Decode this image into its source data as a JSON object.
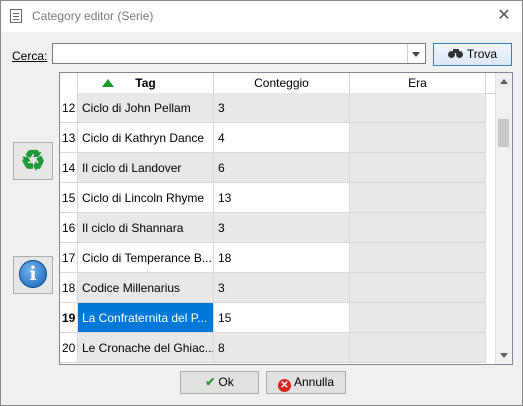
{
  "window": {
    "title": "Category editor (Serie)",
    "close_glyph": "✕"
  },
  "search": {
    "label": "Cerca:",
    "value": "",
    "find_label": "Trova"
  },
  "side_buttons": {
    "recycle_icon": "recycle-icon",
    "info_icon": "info-icon",
    "info_glyph": "i",
    "recycle_glyph": "♻"
  },
  "grid": {
    "columns": [
      "Tag",
      "Conteggio",
      "Era"
    ],
    "sorted_column": "Tag",
    "rows": [
      {
        "num": "12",
        "tag": "Ciclo di John Pellam",
        "count": "3",
        "era": ""
      },
      {
        "num": "13",
        "tag": "Ciclo di Kathryn Dance",
        "count": "4",
        "era": ""
      },
      {
        "num": "14",
        "tag": "Il ciclo di Landover",
        "count": "6",
        "era": ""
      },
      {
        "num": "15",
        "tag": "Ciclo di Lincoln Rhyme",
        "count": "13",
        "era": ""
      },
      {
        "num": "16",
        "tag": "Il ciclo di Shannara",
        "count": "3",
        "era": ""
      },
      {
        "num": "17",
        "tag": "Ciclo di Temperance B...",
        "count": "18",
        "era": ""
      },
      {
        "num": "18",
        "tag": "Codice Millenarius",
        "count": "3",
        "era": ""
      },
      {
        "num": "19",
        "tag": "La Confraternita del P...",
        "count": "15",
        "era": ""
      },
      {
        "num": "20",
        "tag": "Le Cronache del Ghiac...",
        "count": "8",
        "era": ""
      }
    ],
    "selected_row": "19"
  },
  "footer": {
    "ok_label": "Ok",
    "cancel_label": "Annulla"
  },
  "colors": {
    "selection": "#0078d7",
    "sort_arrow": "#1a9b2a",
    "recycle": "#1f9a3a",
    "info": "#1760b5"
  }
}
